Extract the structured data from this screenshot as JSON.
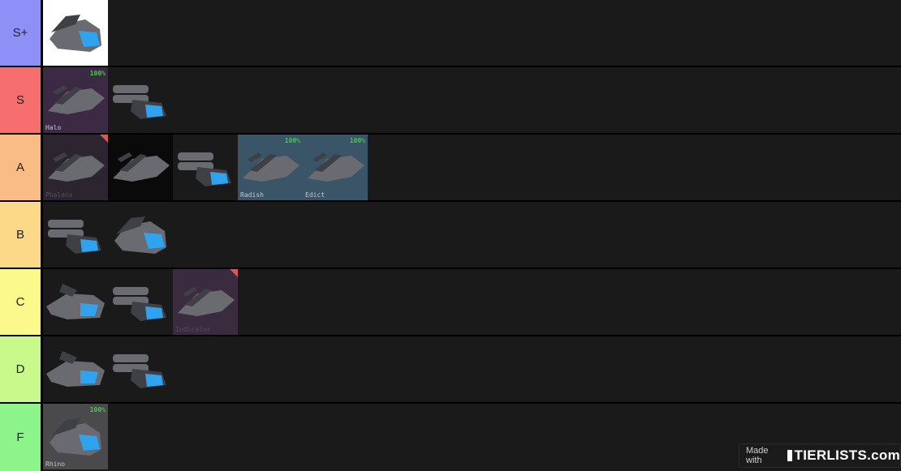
{
  "tiers": [
    {
      "label": "S+",
      "color": "#8f90f7",
      "items": [
        {
          "name": "shuttle-white",
          "bg": "#ffffff"
        }
      ]
    },
    {
      "label": "S",
      "color": "#f76e6e",
      "items": [
        {
          "name": "halo",
          "caption": "Halo",
          "pct": "100%",
          "bg": "#3c2a44"
        },
        {
          "name": "ship-s2",
          "bg": "#1a1a1a"
        }
      ]
    },
    {
      "label": "A",
      "color": "#f9bc84",
      "items": [
        {
          "name": "phalanx",
          "caption": "Phalanx",
          "bg": "#2c2530",
          "corner": true
        },
        {
          "name": "dark-wedge",
          "bg": "#0a0a0a"
        },
        {
          "name": "ship-a3",
          "bg": "#1a1a1a"
        },
        {
          "name": "radish",
          "caption": "Radish",
          "pct": "100%",
          "bg": "#3a5468"
        },
        {
          "name": "edict",
          "caption": "Edict",
          "pct": "100%",
          "bg": "#3a5468"
        }
      ]
    },
    {
      "label": "B",
      "color": "#fcd988",
      "items": [
        {
          "name": "ship-b1",
          "bg": "#1a1a1a"
        },
        {
          "name": "ship-b2",
          "bg": "#1a1a1a"
        }
      ]
    },
    {
      "label": "C",
      "color": "#fbf98b",
      "items": [
        {
          "name": "ship-c1",
          "bg": "#1a1a1a"
        },
        {
          "name": "ship-c2",
          "bg": "#1a1a1a"
        },
        {
          "name": "indicator",
          "caption": "Indicator",
          "bg": "#3a2b3e",
          "corner": true
        }
      ]
    },
    {
      "label": "D",
      "color": "#c9f98b",
      "items": [
        {
          "name": "ship-d1",
          "bg": "#1a1a1a"
        },
        {
          "name": "ship-d2",
          "bg": "#1a1a1a"
        }
      ]
    },
    {
      "label": "F",
      "color": "#8df48b",
      "items": [
        {
          "name": "rhino",
          "caption": "Rhino",
          "pct": "100%",
          "bg": "#4a4a4c"
        }
      ]
    }
  ],
  "watermark": {
    "made_with": "Made with",
    "brand": "TIERLISTS.com"
  },
  "colors": {
    "hull": "#6a6b70",
    "hull_dark": "#3f4045",
    "cockpit": "#2fa3f0"
  }
}
